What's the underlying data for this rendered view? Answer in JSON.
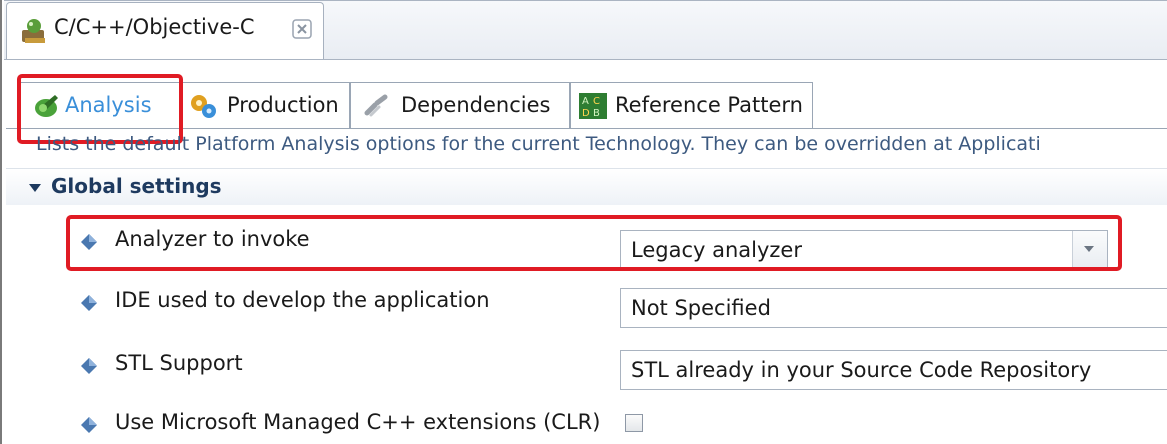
{
  "editor_tab": {
    "title": "C/C++/Objective-C",
    "icon": "technology-icon",
    "close_icon": "close-icon"
  },
  "subtabs": [
    {
      "label": "Analysis",
      "icon": "analysis-icon",
      "active": true
    },
    {
      "label": "Production",
      "icon": "production-icon",
      "active": false
    },
    {
      "label": "Dependencies",
      "icon": "dependencies-icon",
      "active": false
    },
    {
      "label": "Reference Pattern",
      "icon": "reference-pattern-icon",
      "active": false
    }
  ],
  "description": "Lists the default Platform Analysis options for the current Technology. They can be overridden at Applicati",
  "section": {
    "title": "Global settings"
  },
  "settings": [
    {
      "label": "Analyzer to invoke",
      "value": "Legacy analyzer",
      "control": "dropdown"
    },
    {
      "label": "IDE used to develop the application",
      "value": "Not Specified",
      "control": "dropdown"
    },
    {
      "label": "STL Support",
      "value": "STL already in your Source Code Repository",
      "control": "dropdown"
    },
    {
      "label": "Use Microsoft Managed C++ extensions (CLR)",
      "checked": false,
      "control": "checkbox"
    }
  ],
  "colors": {
    "highlight": "#e01b24",
    "active_tab_text": "#3a8fd9",
    "section_title": "#1e3a5f"
  }
}
